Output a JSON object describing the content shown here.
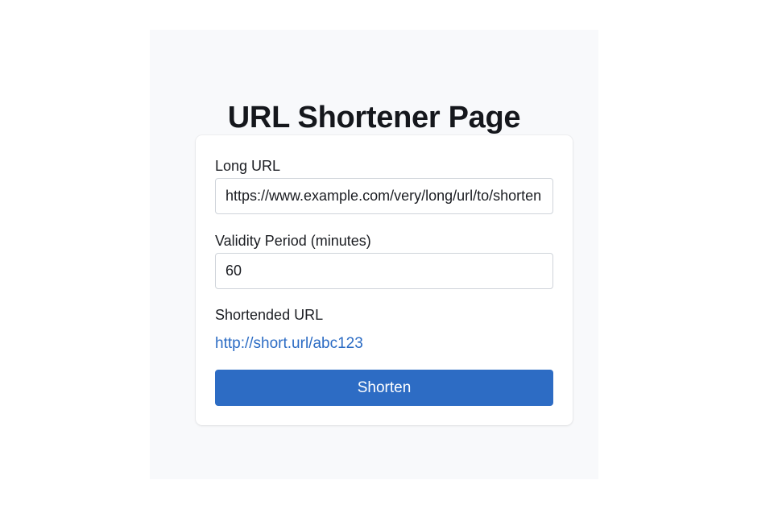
{
  "page": {
    "title": "URL Shortener Page"
  },
  "form": {
    "long_url": {
      "label": "Long URL",
      "value": "https://www.example.com/very/long/url/to/shorten"
    },
    "validity": {
      "label": "Validity Period (minutes)",
      "value": "60"
    },
    "result": {
      "label": "Shortended URL",
      "link_text": "http://short.url/abc123"
    },
    "submit_label": "Shorten"
  },
  "colors": {
    "accent": "#2d6cc4",
    "link": "#2c6cc4",
    "panel_background": "#f8f9fb"
  }
}
